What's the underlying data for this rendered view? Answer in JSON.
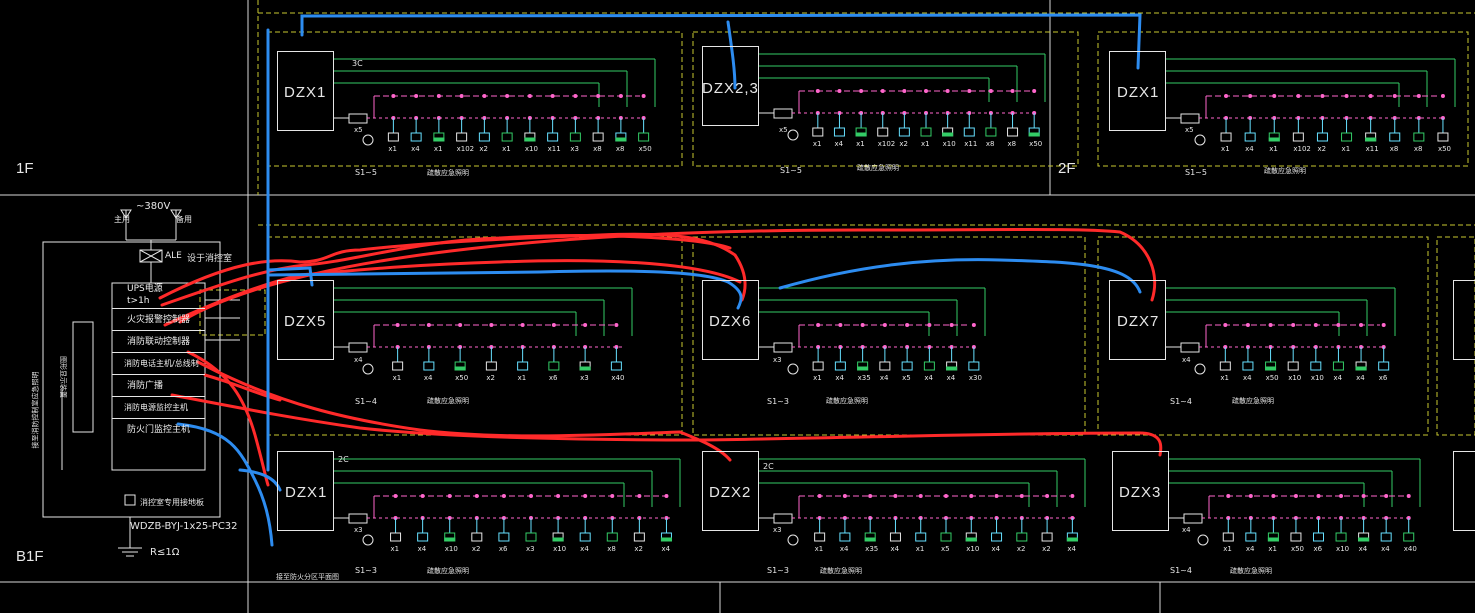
{
  "floors": {
    "f1": "1F",
    "f2": "2F",
    "b1": "B1F"
  },
  "panels": [
    {
      "id": "p1",
      "label": "DZX1",
      "count": "x5",
      "sub": "S1~5",
      "small": "3C"
    },
    {
      "id": "p2",
      "label": "DZX2,3",
      "count": "x5",
      "sub": "S1~5",
      "small": ""
    },
    {
      "id": "p3",
      "label": "DZX1",
      "count": "x5",
      "sub": "S1~5",
      "small": ""
    },
    {
      "id": "p4",
      "label": "DZX5",
      "count": "x4",
      "sub": "S1~4",
      "small": ""
    },
    {
      "id": "p5",
      "label": "DZX6",
      "count": "x3",
      "sub": "S1~3",
      "small": ""
    },
    {
      "id": "p6",
      "label": "DZX7",
      "count": "x4",
      "sub": "S1~4",
      "small": ""
    },
    {
      "id": "p7",
      "label": "DZX1",
      "count": "x3",
      "sub": "S1~3",
      "small": "2C"
    },
    {
      "id": "p8",
      "label": "DZX2",
      "count": "x3",
      "sub": "S1~3",
      "small": "2C"
    },
    {
      "id": "p9",
      "label": "DZX3",
      "count": "x4",
      "sub": "S1~4",
      "small": ""
    }
  ],
  "device_counts": {
    "row1_p1": [
      "x1",
      "x4",
      "x1",
      "x102",
      "x2",
      "x1",
      "x10",
      "x11",
      "x3",
      "x8",
      "x8",
      "x50"
    ],
    "row1_p2": [
      "x1",
      "x4",
      "x1",
      "x102",
      "x2",
      "x1",
      "x10",
      "x11",
      "x8",
      "x8",
      "x50"
    ],
    "row1_p3": [
      "x1",
      "x4",
      "x1",
      "x102",
      "x2",
      "x1",
      "x11",
      "x8",
      "x8",
      "x50"
    ],
    "row2_p4": [
      "x1",
      "x4",
      "x50",
      "x2",
      "x1",
      "x6",
      "x3",
      "x40"
    ],
    "row2_p5": [
      "x1",
      "x4",
      "x35",
      "x4",
      "x5",
      "x4",
      "x4",
      "x30"
    ],
    "row2_p6": [
      "x1",
      "x4",
      "x50",
      "x10",
      "x10",
      "x4",
      "x4",
      "x6"
    ],
    "row3_p7": [
      "x1",
      "x4",
      "x10",
      "x2",
      "x6",
      "x3",
      "x10",
      "x4",
      "x8",
      "x2",
      "x4"
    ],
    "row3_p8": [
      "x1",
      "x4",
      "x35",
      "x4",
      "x1",
      "x5",
      "x10",
      "x4",
      "x2",
      "x2",
      "x4"
    ],
    "row3_p9": [
      "x1",
      "x4",
      "x1",
      "x50",
      "x6",
      "x10",
      "x4",
      "x4",
      "x40"
    ]
  },
  "panel_caption": "疏散应急照明",
  "riser": {
    "supply_voltage": "~380V",
    "main_label": "主用",
    "standby_label": "备用",
    "ale_label": "ALE",
    "room_label": "设于消控室",
    "items": [
      "UPS电源",
      "t>1h",
      "火灾报警控制器",
      "消防联动控制器",
      "消防电话主机/总线制",
      "消防广播",
      "消防电源监控主机",
      "防火门监控主机"
    ],
    "side_box_label": "图形显示装置",
    "left_vertical_text": "接至消防控制室应急照明",
    "grounding_label": "消控室专用接地板",
    "cable_spec": "WDZB-BYJ-1x25-PC32",
    "resistance": "R≤1Ω",
    "bottom_note": "接至防火分区平面图"
  },
  "colors": {
    "background": "#000000",
    "frame": "#e6e6e6",
    "green": "#33cc66",
    "pink": "#ff66cc",
    "cyan": "#66e0ff",
    "yellow_dash": "#c8c830",
    "annotation_red": "#ff2a2a",
    "annotation_blue": "#2d8cf0"
  }
}
